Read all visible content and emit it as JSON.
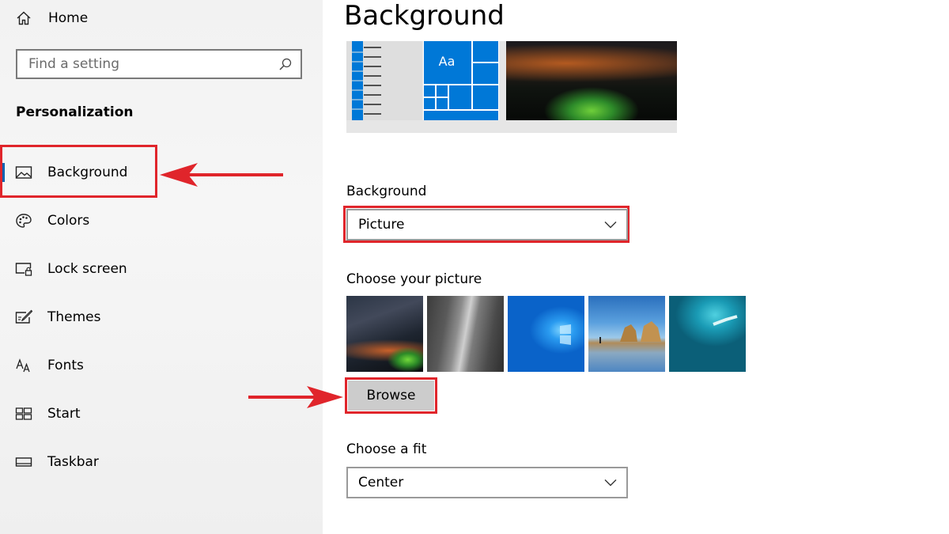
{
  "sidebar": {
    "home_label": "Home",
    "search_placeholder": "Find a setting",
    "section_title": "Personalization",
    "items": [
      {
        "label": "Background",
        "icon": "picture-icon",
        "selected": true
      },
      {
        "label": "Colors",
        "icon": "palette-icon"
      },
      {
        "label": "Lock screen",
        "icon": "lock-screen-icon"
      },
      {
        "label": "Themes",
        "icon": "themes-icon"
      },
      {
        "label": "Fonts",
        "icon": "fonts-icon"
      },
      {
        "label": "Start",
        "icon": "start-icon"
      },
      {
        "label": "Taskbar",
        "icon": "taskbar-icon"
      }
    ]
  },
  "main": {
    "title": "Background",
    "preview": {
      "tile_text": "Aa"
    },
    "background_label": "Background",
    "background_value": "Picture",
    "choose_picture_label": "Choose your picture",
    "browse_label": "Browse",
    "fit_label": "Choose a fit",
    "fit_value": "Center"
  },
  "colors": {
    "accent": "#0078d7",
    "highlight_red": "#e0252b",
    "selection_bar": "#0063b1"
  }
}
